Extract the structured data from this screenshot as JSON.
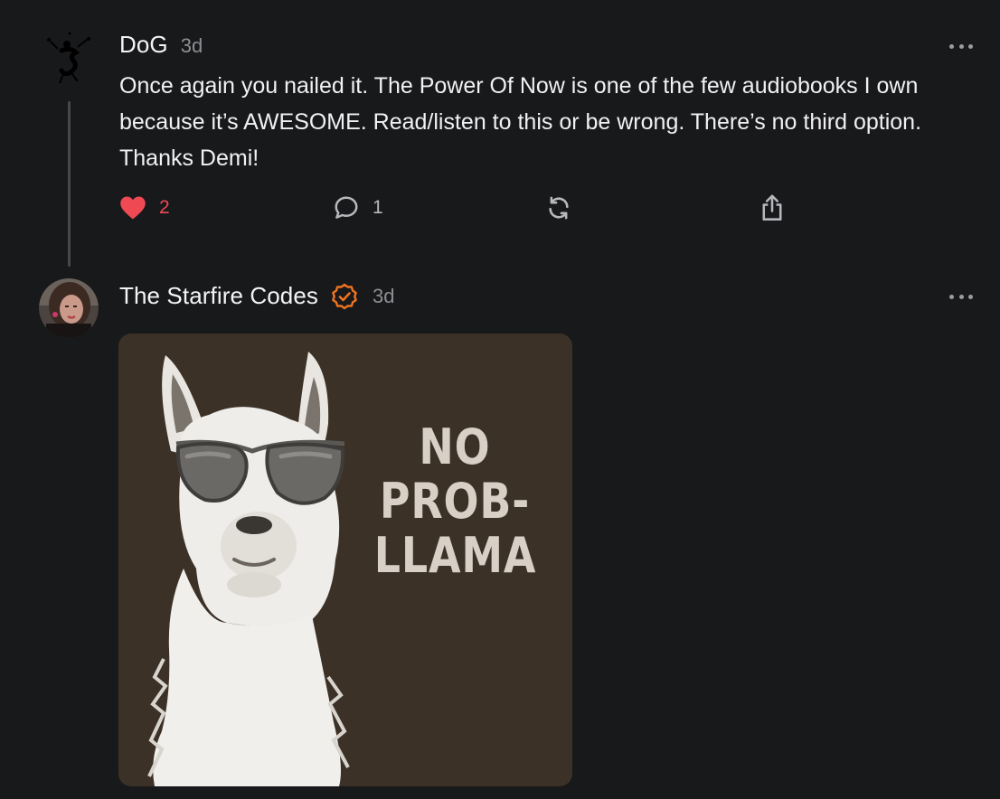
{
  "comments": [
    {
      "author": "DoG",
      "time": "3d",
      "body": "Once again you nailed it. The Power Of Now is one of the few audiobooks I own because it’s AWESOME. Read/listen to this or be wrong. There’s no third option. Thanks Demi!",
      "likes": "2",
      "replies": "1",
      "liked": true
    },
    {
      "author": "The Starfire Codes",
      "time": "3d",
      "verified": true,
      "image_text": [
        "NO",
        "PROB-",
        "LLAMA"
      ]
    }
  ],
  "icons": {
    "like": "heart-icon",
    "reply": "comment-bubble-icon",
    "restack": "restack-icon",
    "share": "share-icon",
    "more": "more-horizontal-icon",
    "verified": "verified-badge-icon"
  },
  "colors": {
    "background": "#18191b",
    "like_active": "#ef4a53",
    "verified": "#f0731e",
    "image_bg": "#3c3127"
  }
}
